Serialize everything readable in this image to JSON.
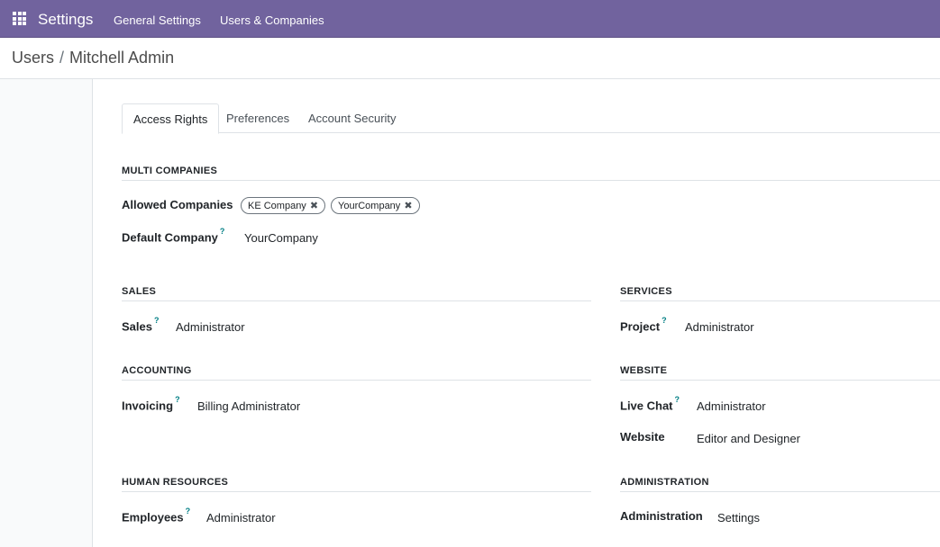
{
  "navbar": {
    "brand": "Settings",
    "menu": [
      "General Settings",
      "Users & Companies"
    ]
  },
  "breadcrumb": {
    "parent": "Users",
    "current": "Mitchell Admin"
  },
  "tabs": [
    "Access Rights",
    "Preferences",
    "Account Security"
  ],
  "multi_companies": {
    "title": "MULTI COMPANIES",
    "allowed_label": "Allowed Companies",
    "allowed_tags": [
      "KE Company",
      "YourCompany"
    ],
    "default_label": "Default Company",
    "default_value": "YourCompany"
  },
  "help_marker": "?",
  "tag_remove_glyph": "✖",
  "sales": {
    "title": "SALES",
    "label": "Sales",
    "value": "Administrator"
  },
  "accounting": {
    "title": "ACCOUNTING",
    "label": "Invoicing",
    "value": "Billing Administrator"
  },
  "human_resources": {
    "title": "HUMAN RESOURCES",
    "label": "Employees",
    "value": "Administrator"
  },
  "services": {
    "title": "SERVICES",
    "label": "Project",
    "value": "Administrator"
  },
  "website": {
    "title": "WEBSITE",
    "livechat_label": "Live Chat",
    "livechat_value": "Administrator",
    "website_label": "Website",
    "website_value": "Editor and Designer"
  },
  "administration": {
    "title": "ADMINISTRATION",
    "label": "Administration",
    "value": "Settings"
  }
}
